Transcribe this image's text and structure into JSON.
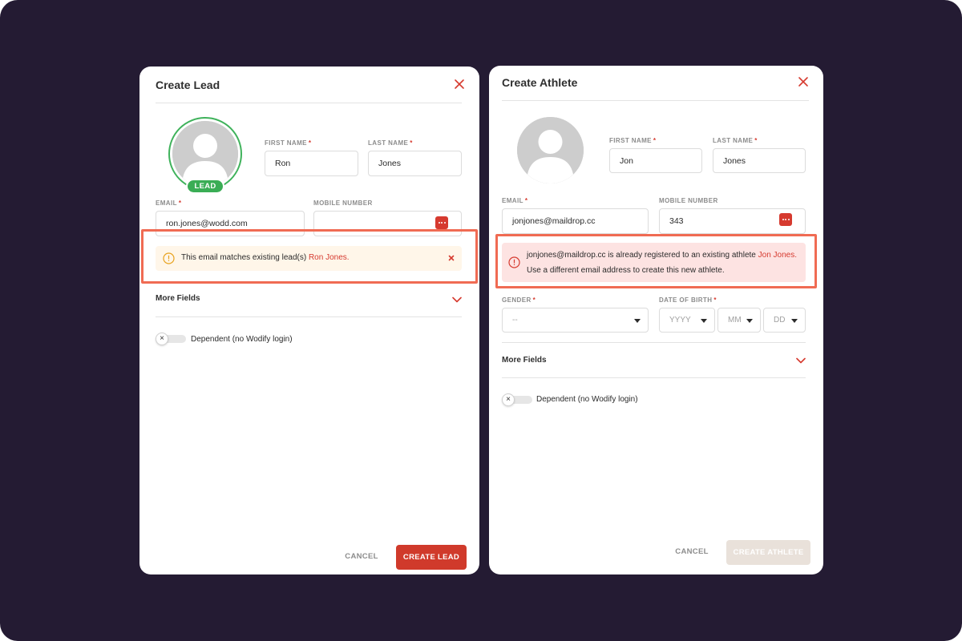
{
  "lead_modal": {
    "title": "Create Lead",
    "badge": "LEAD",
    "first_name": {
      "label": "FIRST NAME",
      "required": "*",
      "value": "Ron"
    },
    "last_name": {
      "label": "LAST NAME",
      "required": "*",
      "value": "Jones"
    },
    "email": {
      "label": "EMAIL",
      "required": "*",
      "value": "ron.jones@wodd.com"
    },
    "mobile": {
      "label": "MOBILE NUMBER",
      "value": ""
    },
    "warning": {
      "text": "This email matches existing lead(s) ",
      "link": "Ron Jones."
    },
    "more_fields": "More Fields",
    "dependent_label": "Dependent (no Wodify login)",
    "cancel": "CANCEL",
    "submit": "CREATE LEAD"
  },
  "athlete_modal": {
    "title": "Create Athlete",
    "first_name": {
      "label": "FIRST NAME",
      "required": "*",
      "value": "Jon"
    },
    "last_name": {
      "label": "LAST NAME",
      "required": "*",
      "value": "Jones"
    },
    "email": {
      "label": "EMAIL",
      "required": "*",
      "value": "jonjones@maildrop.cc"
    },
    "mobile": {
      "label": "MOBILE NUMBER",
      "value": "343"
    },
    "error": {
      "line1_text": "jonjones@maildrop.cc is already registered to an existing athlete ",
      "line1_link": "Jon Jones.",
      "line2_text": "Use a different email address to create this new athlete."
    },
    "gender": {
      "label": "GENDER",
      "required": "*",
      "value": "--"
    },
    "dob": {
      "label": "DATE OF BIRTH",
      "required": "*",
      "year": "YYYY",
      "month": "MM",
      "day": "DD"
    },
    "more_fields": "More Fields",
    "dependent_label": "Dependent (no Wodify login)",
    "cancel": "CANCEL",
    "submit": "CREATE ATHLETE"
  },
  "colors": {
    "background": "#241b33",
    "accent_red": "#d03a2b",
    "highlight": "#f06b53",
    "lead_green": "#3aad55",
    "warning_bg": "#fff6e9",
    "error_bg": "#fde3e2"
  },
  "icons": [
    "close-icon",
    "user-avatar-icon",
    "more-dots-icon",
    "warning-circle-icon",
    "error-circle-icon",
    "chevron-down-icon",
    "toggle-x-icon",
    "caret-down-icon"
  ]
}
